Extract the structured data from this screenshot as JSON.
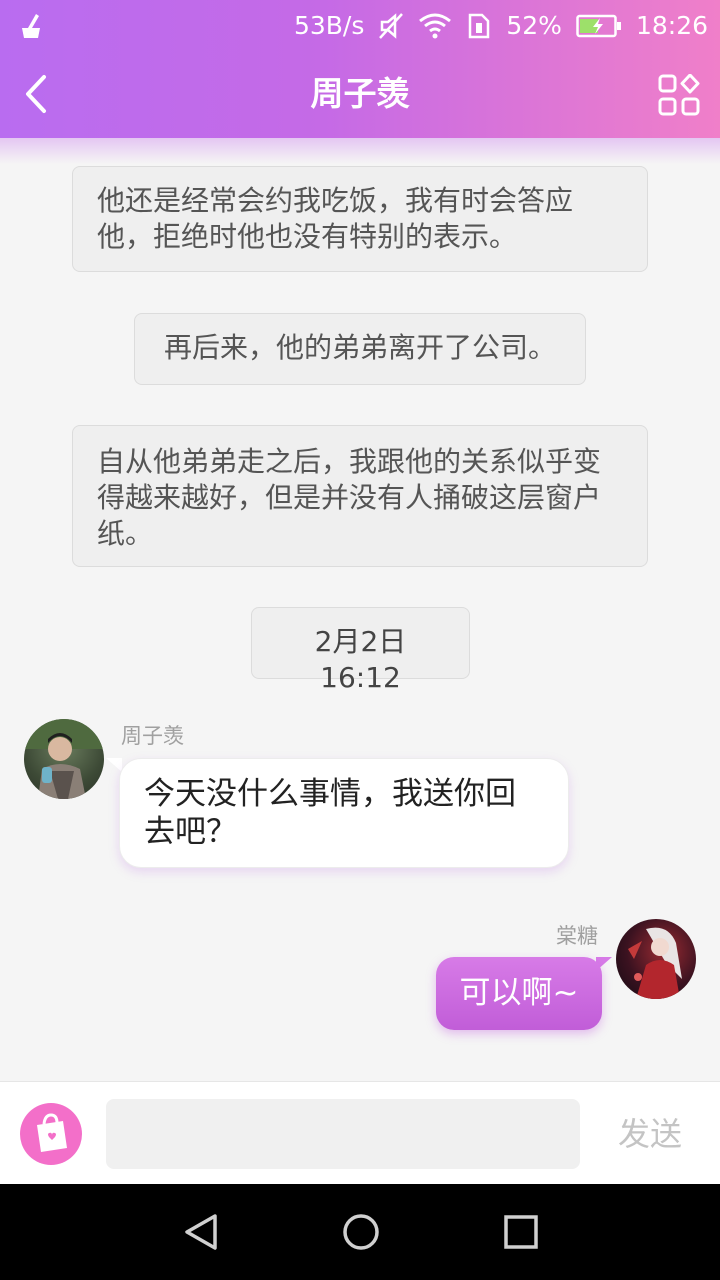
{
  "status_bar": {
    "net_speed": "53B/s",
    "battery": "52%",
    "time": "18:26"
  },
  "header": {
    "title": "周子羡"
  },
  "messages": {
    "system_1": "他还是经常会约我吃饭，我有时会答应他，拒绝时他也没有特别的表示。",
    "system_2": "再后来，他的弟弟离开了公司。",
    "system_3": "自从他弟弟走之后，我跟他的关系似乎变得越来越好，但是并没有人捅破这层窗户纸。",
    "timestamp": "2月2日16:12",
    "incoming": {
      "sender": "周子羡",
      "text": "今天没什么事情，我送你回去吧？"
    },
    "outgoing": {
      "sender": "棠糖",
      "text": "可以啊~"
    }
  },
  "input_bar": {
    "placeholder": "",
    "send_label": "发送"
  },
  "colors": {
    "header_start": "#b96cf0",
    "header_end": "#f07fc9",
    "outgoing_bubble": "#c15dd8",
    "bag_button": "#f36fc9"
  },
  "icons": [
    "clean-icon",
    "mute-icon",
    "wifi-icon",
    "sim-icon",
    "battery-icon",
    "back-arrow-icon",
    "grid-menu-icon",
    "shopping-bag-icon",
    "nav-back-icon",
    "nav-home-icon",
    "nav-recent-icon"
  ]
}
